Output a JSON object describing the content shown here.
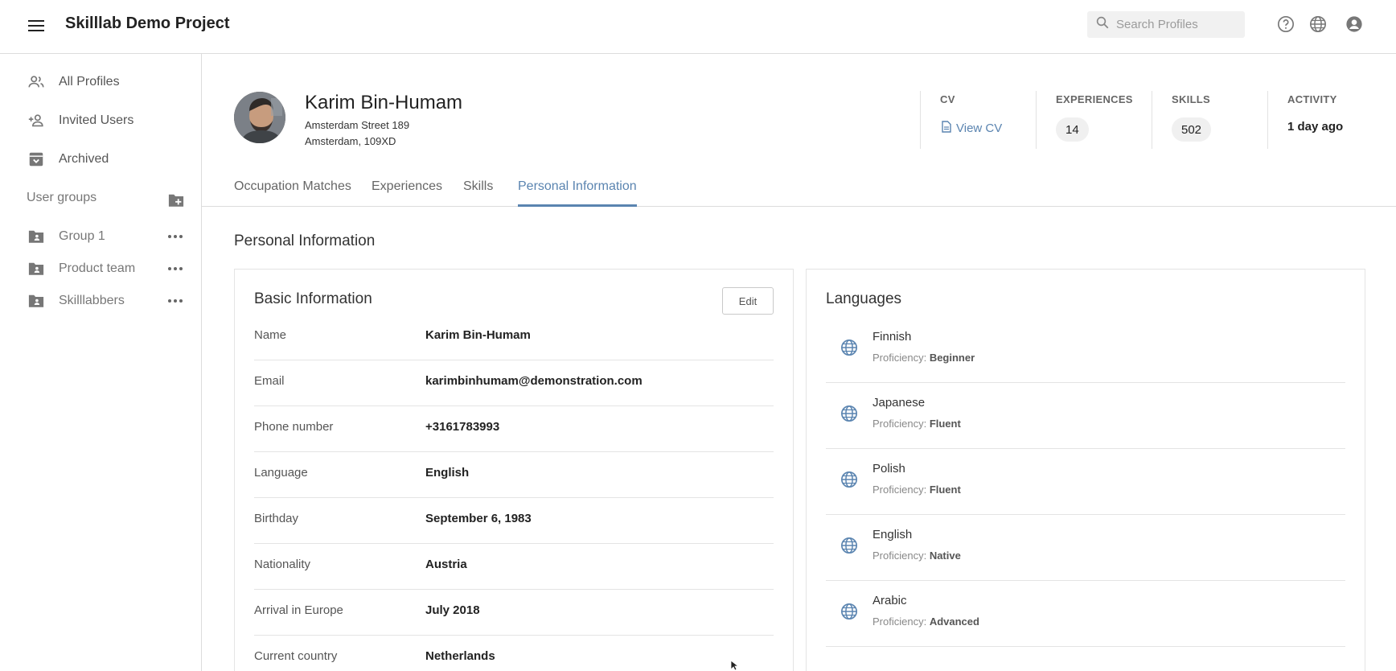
{
  "header": {
    "app_title": "Skilllab Demo Project",
    "search_placeholder": "Search Profiles"
  },
  "sidebar": {
    "items": [
      {
        "label": "All Profiles",
        "icon": "people-icon"
      },
      {
        "label": "Invited Users",
        "icon": "add-person-icon"
      },
      {
        "label": "Archived",
        "icon": "archive-icon"
      }
    ],
    "user_groups_label": "User groups",
    "groups": [
      {
        "label": "Group 1"
      },
      {
        "label": "Product team"
      },
      {
        "label": "Skilllabbers"
      }
    ]
  },
  "profile": {
    "name": "Karim Bin-Humam",
    "address_line1": "Amsterdam Street 189",
    "address_line2": "Amsterdam, 109XD",
    "stats": {
      "cv_label": "CV",
      "cv_link": "View CV",
      "experiences_label": "EXPERIENCES",
      "experiences_value": "14",
      "skills_label": "SKILLS",
      "skills_value": "502",
      "activity_label": "ACTIVITY",
      "activity_value": "1 day ago"
    }
  },
  "tabs": [
    {
      "label": "Occupation Matches"
    },
    {
      "label": "Experiences"
    },
    {
      "label": "Skills"
    },
    {
      "label": "Personal Information",
      "active": true
    }
  ],
  "section_title": "Personal Information",
  "basic_info": {
    "title": "Basic Information",
    "edit_label": "Edit",
    "rows": [
      {
        "key": "Name",
        "value": "Karim Bin-Humam"
      },
      {
        "key": "Email",
        "value": "karimbinhumam@demonstration.com"
      },
      {
        "key": "Phone number",
        "value": "+3161783993"
      },
      {
        "key": "Language",
        "value": "English"
      },
      {
        "key": "Birthday",
        "value": "September 6, 1983"
      },
      {
        "key": "Nationality",
        "value": "Austria"
      },
      {
        "key": "Arrival in Europe",
        "value": "July 2018"
      },
      {
        "key": "Current country",
        "value": "Netherlands"
      }
    ]
  },
  "languages": {
    "title": "Languages",
    "proficiency_prefix": "Proficiency: ",
    "items": [
      {
        "name": "Finnish",
        "level": "Beginner"
      },
      {
        "name": "Japanese",
        "level": "Fluent"
      },
      {
        "name": "Polish",
        "level": "Fluent"
      },
      {
        "name": "English",
        "level": "Native"
      },
      {
        "name": "Arabic",
        "level": "Advanced"
      }
    ]
  },
  "colors": {
    "accent": "#5a84b0",
    "icon_gray": "#777777",
    "border": "#dcdcdc"
  }
}
